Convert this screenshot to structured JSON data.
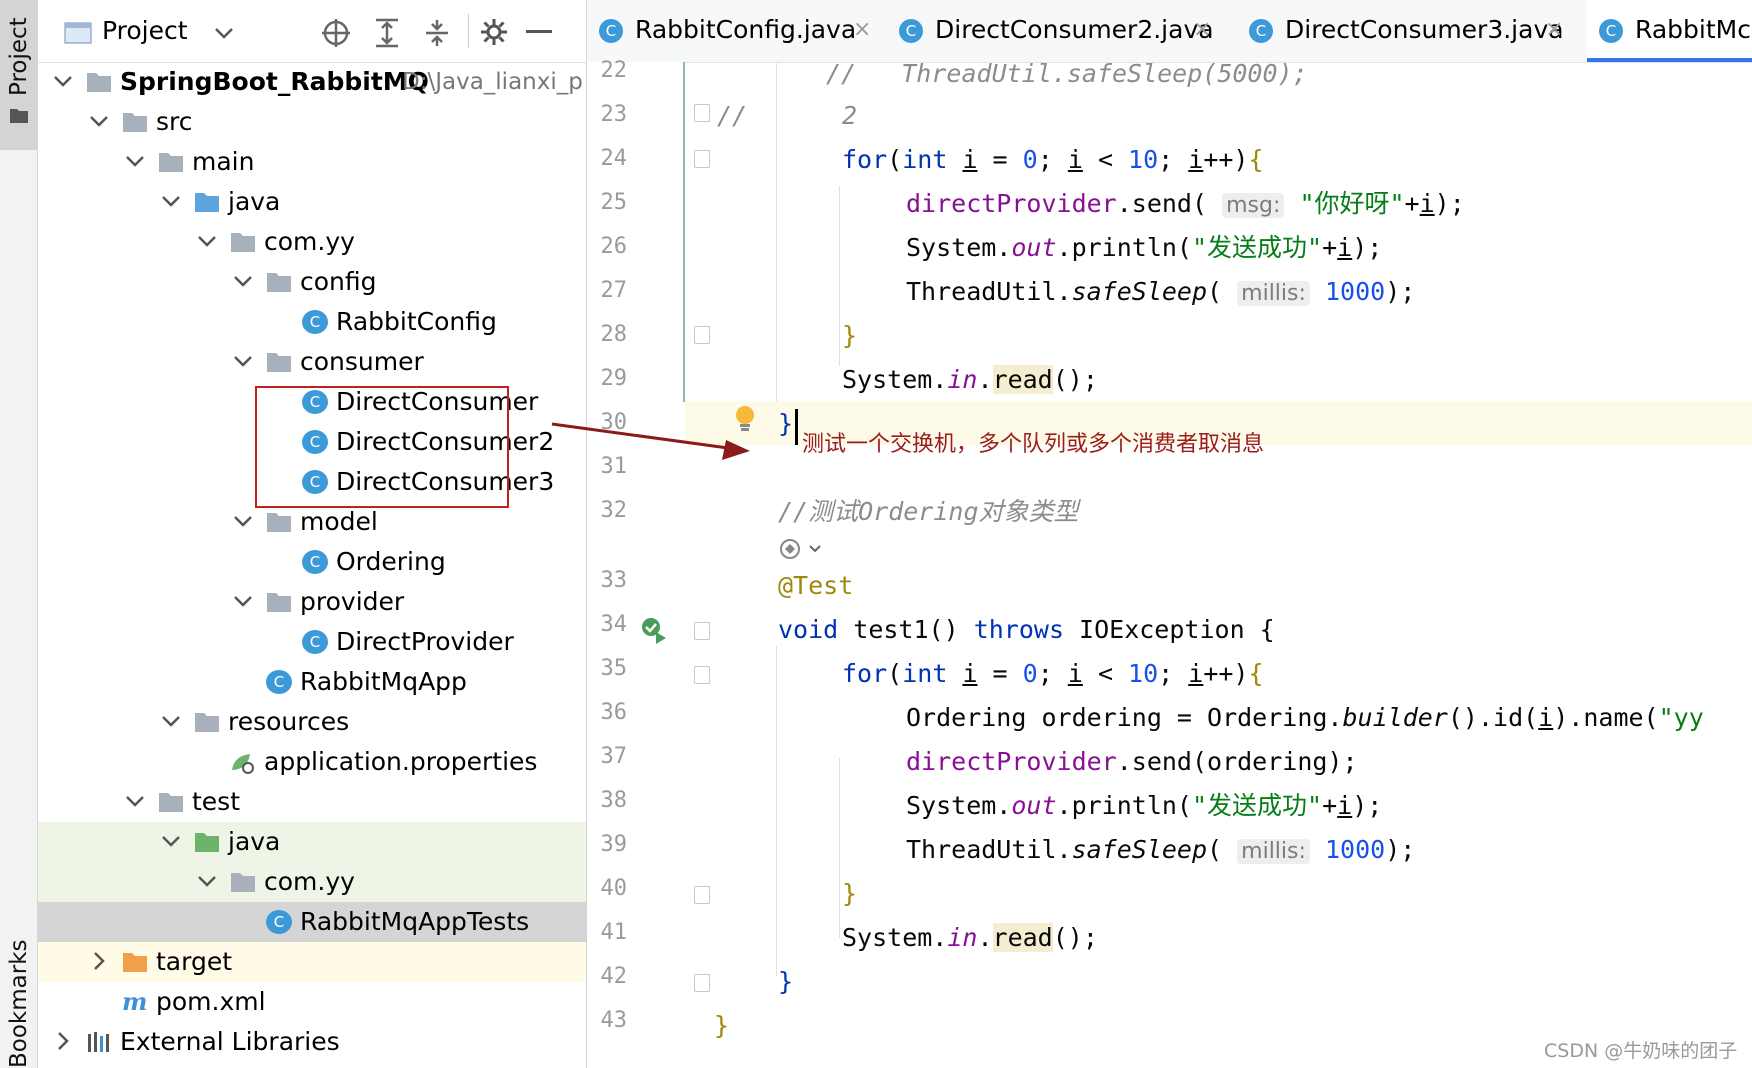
{
  "sidebar": {
    "project_tab": "Project",
    "bookmarks_tab": "Bookmarks"
  },
  "project_panel": {
    "title": "Project",
    "tree": [
      {
        "label": "SpringBoot_RabbitMQ",
        "path": "D:\\Java_lianxi_p",
        "icon": "module-icon"
      },
      {
        "label": "src",
        "icon": "folder-icon"
      },
      {
        "label": "main",
        "icon": "folder-icon"
      },
      {
        "label": "java",
        "icon": "source-folder-icon"
      },
      {
        "label": "com.yy",
        "icon": "package-icon"
      },
      {
        "label": "config",
        "icon": "package-icon"
      },
      {
        "label": "RabbitConfig",
        "icon": "class-icon"
      },
      {
        "label": "consumer",
        "icon": "package-icon"
      },
      {
        "label": "DirectConsumer",
        "icon": "class-icon"
      },
      {
        "label": "DirectConsumer2",
        "icon": "class-icon"
      },
      {
        "label": "DirectConsumer3",
        "icon": "class-icon"
      },
      {
        "label": "model",
        "icon": "package-icon"
      },
      {
        "label": "Ordering",
        "icon": "class-icon"
      },
      {
        "label": "provider",
        "icon": "package-icon"
      },
      {
        "label": "DirectProvider",
        "icon": "class-icon"
      },
      {
        "label": "RabbitMqApp",
        "icon": "spring-class-icon"
      },
      {
        "label": "resources",
        "icon": "resources-folder-icon"
      },
      {
        "label": "application.properties",
        "icon": "spring-properties-icon"
      },
      {
        "label": "test",
        "icon": "folder-icon"
      },
      {
        "label": "java",
        "icon": "test-folder-icon"
      },
      {
        "label": "com.yy",
        "icon": "package-icon"
      },
      {
        "label": "RabbitMqAppTests",
        "icon": "spring-class-icon"
      },
      {
        "label": "target",
        "icon": "excluded-folder-icon"
      },
      {
        "label": "pom.xml",
        "icon": "maven-icon"
      },
      {
        "label": "External Libraries",
        "icon": "libraries-icon"
      }
    ]
  },
  "tabs": [
    {
      "label": "RabbitConfig.java",
      "close": "×"
    },
    {
      "label": "DirectConsumer2.java",
      "close": "×"
    },
    {
      "label": "DirectConsumer3.java",
      "close": "×"
    },
    {
      "label": "RabbitMc",
      "close": ""
    }
  ],
  "editor": {
    "line_numbers": [
      "22",
      "23",
      "24",
      "25",
      "26",
      "27",
      "28",
      "29",
      "30",
      "31",
      "32",
      "33",
      "34",
      "35",
      "36",
      "37",
      "38",
      "39",
      "40",
      "41",
      "42",
      "43"
    ],
    "annotation": "测试一个交换机，多个队列或多个消费者取消息",
    "watermark": "CSDN @牛奶味的团子",
    "hint_msg": "msg:",
    "hint_millis": "millis:",
    "code": {
      "l22": "//   ThreadUtil.safeSleep(5000);",
      "l23_a": "//",
      "l23_b": "2",
      "for": "for",
      "int": "int",
      "i": "i",
      "zero": "0",
      "ten": "10",
      "directProvider": "directProvider",
      "send": ".send(",
      "str_nihao": "\"你好呀\"",
      "system": "System.",
      "out": "out",
      "println": ".println(",
      "str_success": "\"发送成功\"",
      "threadutil": "ThreadUtil.",
      "safeSleep": "safeSleep",
      "n1000": "1000",
      "in": "in",
      "read": "read",
      "brace_close": "}",
      "comment32": "//测试Ordering对象类型",
      "atTest": "@Test",
      "void": "void",
      "test1": " test1() ",
      "throws": "throws",
      "ioexc": " IOException {",
      "ordering_decl": "Ordering ordering = Ordering.",
      "builder": "builder",
      "ordering_rest": "().id(",
      "name": ").name(",
      "str_yy": "\"yy",
      "send_ordering": ".send(ordering);"
    }
  }
}
